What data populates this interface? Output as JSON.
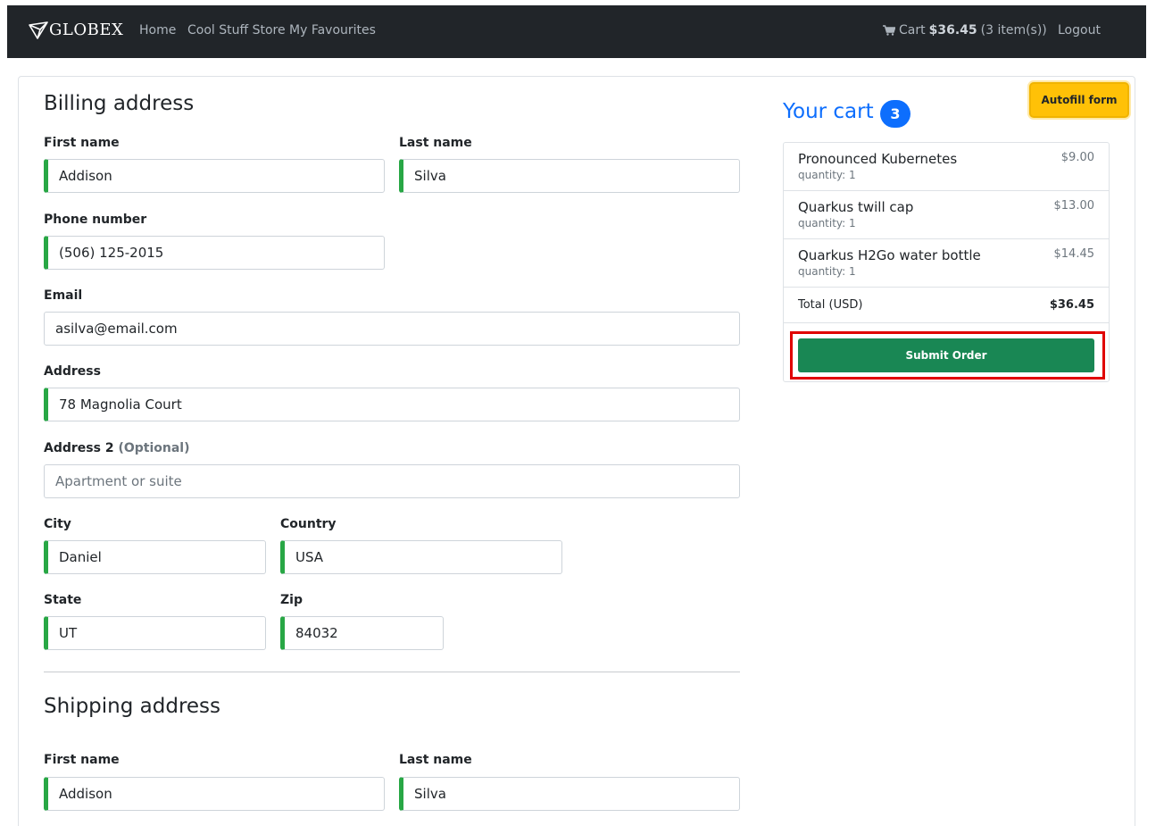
{
  "nav": {
    "brand": "GLOBEX",
    "links": [
      "Home",
      "Cool Stuff Store",
      "My Favourites"
    ],
    "cart_label": "Cart",
    "cart_total": "$36.45",
    "cart_items": "(3 item(s))",
    "logout": "Logout"
  },
  "billing": {
    "title": "Billing address",
    "first_name_label": "First name",
    "first_name": "Addison",
    "last_name_label": "Last name",
    "last_name": "Silva",
    "phone_label": "Phone number",
    "phone": "(506) 125-2015",
    "email_label": "Email",
    "email": "asilva@email.com",
    "address_label": "Address",
    "address": "78 Magnolia Court",
    "address2_label": "Address 2",
    "address2_optional": "(Optional)",
    "address2_placeholder": "Apartment or suite",
    "city_label": "City",
    "city": "Daniel",
    "country_label": "Country",
    "country": "USA",
    "state_label": "State",
    "state": "UT",
    "zip_label": "Zip",
    "zip": "84032"
  },
  "shipping": {
    "title": "Shipping address",
    "first_name_label": "First name",
    "first_name": "Addison",
    "last_name_label": "Last name",
    "last_name": "Silva"
  },
  "autofill_label": "Autofill form",
  "cart": {
    "title": "Your cart",
    "count": "3",
    "items": [
      {
        "name": "Pronounced Kubernetes",
        "qty": "quantity: 1",
        "price": "$9.00"
      },
      {
        "name": "Quarkus twill cap",
        "qty": "quantity: 1",
        "price": "$13.00"
      },
      {
        "name": "Quarkus H2Go water bottle",
        "qty": "quantity: 1",
        "price": "$14.45"
      }
    ],
    "total_label": "Total (USD)",
    "total_value": "$36.45",
    "submit_label": "Submit Order"
  },
  "colors": {
    "navbar_bg": "#212529",
    "valid_border": "#28a745",
    "primary": "#0d6efd",
    "submit_bg": "#198754",
    "autofill_bg": "#ffc107",
    "highlight": "#e00000"
  }
}
